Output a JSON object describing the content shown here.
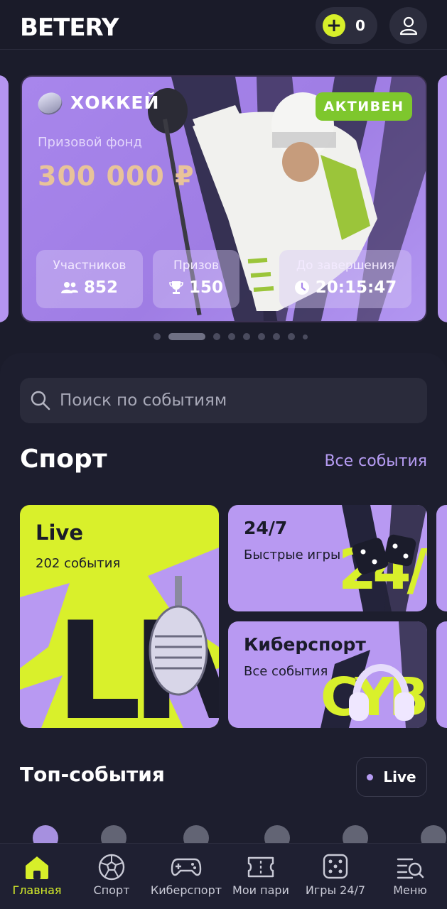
{
  "header": {
    "logo_text": "BETERY",
    "balance": "0"
  },
  "banner": {
    "sport": "ХОККЕЙ",
    "status": "АКТИВЕН",
    "prize_label": "Призовой фонд",
    "prize_amount": "300 000 ₽",
    "stats": [
      {
        "label": "Участников",
        "value": "852",
        "icon": "users-icon"
      },
      {
        "label": "Призов",
        "value": "150",
        "icon": "trophy-icon"
      },
      {
        "label": "До завершения",
        "value": "20:15:47",
        "icon": "clock-icon"
      }
    ],
    "pagination": {
      "total": 9,
      "active_index": 1
    }
  },
  "search": {
    "placeholder": "Поиск по событиям"
  },
  "sport_section": {
    "title": "Спорт",
    "all_events_link": "Все события",
    "tiles": {
      "live": {
        "title": "Live",
        "subtitle": "202 события"
      },
      "quick": {
        "title": "24/7",
        "subtitle": "Быстрые игры"
      },
      "esports": {
        "title": "Киберспорт",
        "subtitle": "Все события"
      }
    }
  },
  "top_events": {
    "title": "Топ-события",
    "live_button": "Live"
  },
  "bottom_nav": {
    "items": [
      {
        "label": "Главная",
        "icon": "home-icon",
        "active": true
      },
      {
        "label": "Спорт",
        "icon": "soccer-ball-icon",
        "active": false
      },
      {
        "label": "Киберспорт",
        "icon": "gamepad-icon",
        "active": false
      },
      {
        "label": "Мои пари",
        "icon": "ticket-icon",
        "active": false
      },
      {
        "label": "Игры 24/7",
        "icon": "dice-icon",
        "active": false
      },
      {
        "label": "Меню",
        "icon": "menu-search-icon",
        "active": false
      }
    ]
  },
  "colors": {
    "accent_lime": "#d7ef2a",
    "accent_purple": "#b899f2",
    "background": "#1b1c2b",
    "status_green": "#7ec72d",
    "prize_gold": "#e8c39a"
  }
}
